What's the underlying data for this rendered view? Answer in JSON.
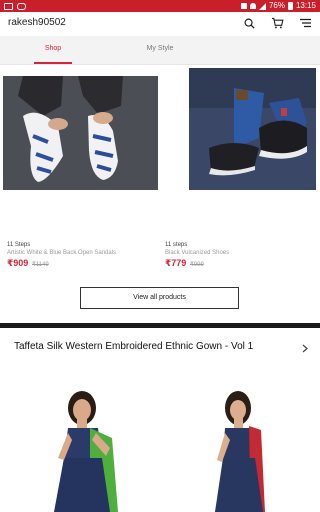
{
  "status_bar": {
    "battery": "76%",
    "time": "13:15"
  },
  "header": {
    "username": "rakesh90502"
  },
  "tabs": [
    {
      "label": "Shop",
      "active": true
    },
    {
      "label": "My Style",
      "active": false
    }
  ],
  "products": [
    {
      "steps": "11 Steps",
      "name": "Artistic White & Blue Back Open Sandals",
      "price": "₹909",
      "mrp": "₹1149"
    },
    {
      "steps": "11 steps",
      "name": "Black Vulcanized Shoes",
      "price": "₹779",
      "mrp": "₹999"
    }
  ],
  "view_all_label": "View all products",
  "collection": {
    "title": "Taffeta Silk Western Embroidered Ethnic Gown - Vol 1"
  },
  "colors": {
    "status_bar": "#c91f2b",
    "accent": "#d6243b"
  }
}
